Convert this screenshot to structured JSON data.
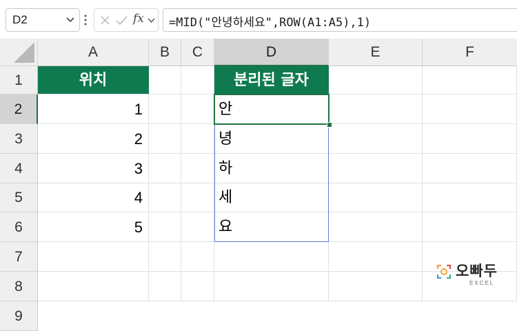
{
  "formula_bar": {
    "name_box": "D2",
    "fx_label": "fx",
    "formula": "=MID(\"안녕하세요\",ROW(A1:A5),1)"
  },
  "columns": [
    "A",
    "B",
    "C",
    "D",
    "E",
    "F"
  ],
  "rows": [
    "1",
    "2",
    "3",
    "4",
    "5",
    "6",
    "7",
    "8",
    "9"
  ],
  "selected_cell": "D2",
  "cells": {
    "A1": "위치",
    "A2": "1",
    "A3": "2",
    "A4": "3",
    "A5": "4",
    "A6": "5",
    "D1": "분리된 글자",
    "D2": "안",
    "D3": "녕",
    "D4": "하",
    "D5": "세",
    "D6": "요"
  },
  "colors": {
    "header_fill": "#0f7a4f",
    "selection": "#217346",
    "spill_border": "#5b7fd8"
  },
  "logo": {
    "name": "오빠두",
    "subtitle": "EXCEL"
  }
}
